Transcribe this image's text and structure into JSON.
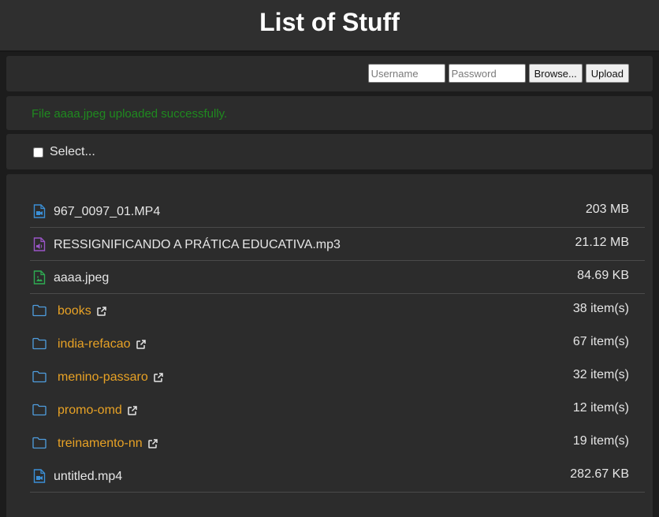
{
  "header": {
    "title": "List of Stuff"
  },
  "login": {
    "username_placeholder": "Username",
    "password_placeholder": "Password",
    "browse_label": "Browse...",
    "upload_label": "Upload"
  },
  "status": {
    "message": "File aaaa.jpeg uploaded successfully.",
    "color": "#1f8a1f"
  },
  "select": {
    "label": "Select..."
  },
  "colors": {
    "folder_link": "#e8a225",
    "video_icon": "#3b8fd6",
    "audio_icon": "#9a55c7",
    "image_icon": "#2eab52",
    "folder_icon": "#4f9ee0"
  },
  "files": [
    {
      "name": "967_0097_01.MP4",
      "size": "203 MB",
      "kind": "video",
      "icon": "file-video-icon"
    },
    {
      "name": "RESSIGNIFICANDO A PRÁTICA EDUCATIVA.mp3",
      "size": "21.12 MB",
      "kind": "audio",
      "icon": "file-audio-icon"
    },
    {
      "name": "aaaa.jpeg",
      "size": "84.69 KB",
      "kind": "image",
      "icon": "file-image-icon"
    },
    {
      "name": "books",
      "size": "38 item(s)",
      "kind": "folder",
      "icon": "folder-icon"
    },
    {
      "name": "india-refacao",
      "size": "67 item(s)",
      "kind": "folder",
      "icon": "folder-icon"
    },
    {
      "name": "menino-passaro",
      "size": "32 item(s)",
      "kind": "folder",
      "icon": "folder-icon"
    },
    {
      "name": "promo-omd",
      "size": "12 item(s)",
      "kind": "folder",
      "icon": "folder-icon"
    },
    {
      "name": "treinamento-nn",
      "size": "19 item(s)",
      "kind": "folder",
      "icon": "folder-icon"
    },
    {
      "name": "untitled.mp4",
      "size": "282.67 KB",
      "kind": "video",
      "icon": "file-video-icon"
    }
  ]
}
